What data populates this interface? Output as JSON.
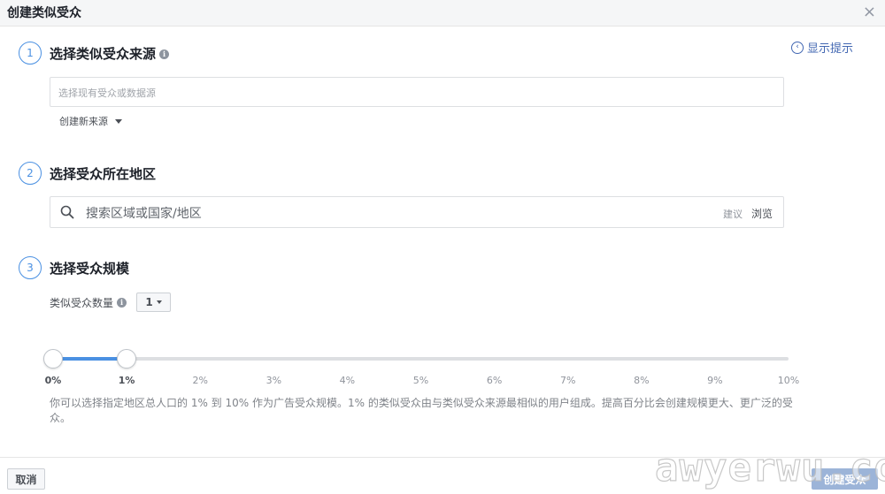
{
  "dialog": {
    "title": "创建类似受众",
    "close": "×",
    "hint": "显示提示"
  },
  "step1": {
    "number": "1",
    "title": "选择类似受众来源",
    "input_placeholder": "选择现有受众或数据源",
    "create_new_source": "创建新来源"
  },
  "step2": {
    "number": "2",
    "title": "选择受众所在地区",
    "search_placeholder": "搜索区域或国家/地区",
    "suggest": "建议",
    "browse": "浏览"
  },
  "step3": {
    "number": "3",
    "title": "选择受众规模",
    "count_label": "类似受众数量",
    "count_value": "1",
    "slider": {
      "ticks": [
        "0%",
        "1%",
        "2%",
        "3%",
        "4%",
        "5%",
        "6%",
        "7%",
        "8%",
        "9%",
        "10%"
      ],
      "range_start_percent": 0,
      "range_end_percent": 1,
      "fill_color": "#4a90e2"
    },
    "description": "你可以选择指定地区总人口的 1% 到 10% 作为广告受众规模。1% 的类似受众由与类似受众来源最相似的用户组成。提高百分比会创建规模更大、更广泛的受众。"
  },
  "footer": {
    "cancel": "取消",
    "create": "创建受众"
  },
  "watermark": "awyerwu.com",
  "colors": {
    "accent": "#4a90e2",
    "link": "#4267b2",
    "primary_button_disabled": "#9cb4d8"
  }
}
